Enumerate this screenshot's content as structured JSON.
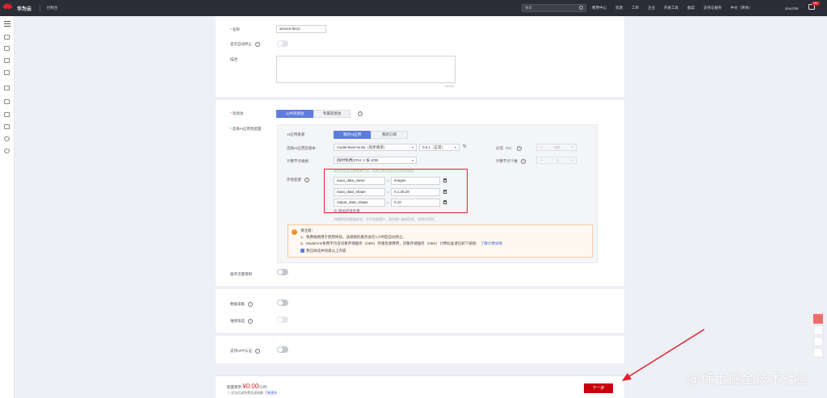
{
  "topnav": {
    "brand": "华为云",
    "region": "控制台",
    "search_placeholder": "搜索",
    "links": [
      "费用中心",
      "资源",
      "工单",
      "企业",
      "开发工具",
      "备案",
      "支持与服务",
      "中文（简体）"
    ],
    "username": "xiaozhi6",
    "badge": "99+"
  },
  "form": {
    "name_label": "名称",
    "name_value": "service-8212",
    "auto_stop_label": "是否自动停止",
    "desc_label": "描述",
    "desc_counter": "0/100",
    "resource_pool_label": "资源池",
    "tab_public": "公共资源池",
    "tab_dedicated": "专属资源池",
    "select_model_label": "选择AI应用及配置",
    "ai_source_label": "AI应用来源",
    "tab_my_ai": "我的AI应用",
    "tab_my_sub": "我的订阅",
    "model_version_label": "选择AI应用及版本",
    "model_value": "model-level-mnist（同步请求）",
    "version_value": "0.0.1（正常）",
    "weight_label": "分流（%）",
    "weight_value": "100",
    "flavor_label": "计算节点规格",
    "flavor_value": "[限时免费]CPU: 1 核 4GB",
    "node_count_label": "计算节点个数",
    "node_count_value": "1",
    "env_label": "环境变量",
    "env_hint": "请勿在此处设置敏感信息，如需设置请使用密钥管理服务",
    "env_vars": [
      {
        "key": "input_data_name",
        "value": "images"
      },
      {
        "key": "input_data_shape",
        "value": "0,1,28,28"
      },
      {
        "key": "output_data_shape",
        "value": "0,10"
      }
    ],
    "add_env": "增加环境变量",
    "env_tip": "为确保您的数据安全，在环境变量中，请勿输入敏感信息，如明文密码。",
    "notice_title": "请注意：",
    "notice_1": "1、免费规格用于使用体验，该规格的服务会在1小时后自动停止。",
    "notice_2": "2、ModelArts免费不包含对象存储服务（OBS）存储资源费用，对象存储服务（OBS）计费标准请见如下链接：",
    "notice_link": "了解计费详情",
    "notice_check": "我已阅读并同意以上内容",
    "traffic_limit_label": "服务流量限制",
    "data_collect_label": "数据采集",
    "hard_example_label": "难例筛选",
    "app_auth_label": "支持APP认证"
  },
  "footer": {
    "fee_label": "配置费用",
    "price": "¥0.00",
    "unit": "/小时",
    "sub_text": "优先扣减免费资源限额",
    "sub_link": "了解更多",
    "next": "下一步"
  },
  "watermark": "@稀土掘金技术社区",
  "colors": {
    "accent": "#5e7ce0",
    "primary_button": "#c7000b",
    "highlight_box": "#e0212c",
    "annotation_arrow": "#e0212c"
  }
}
